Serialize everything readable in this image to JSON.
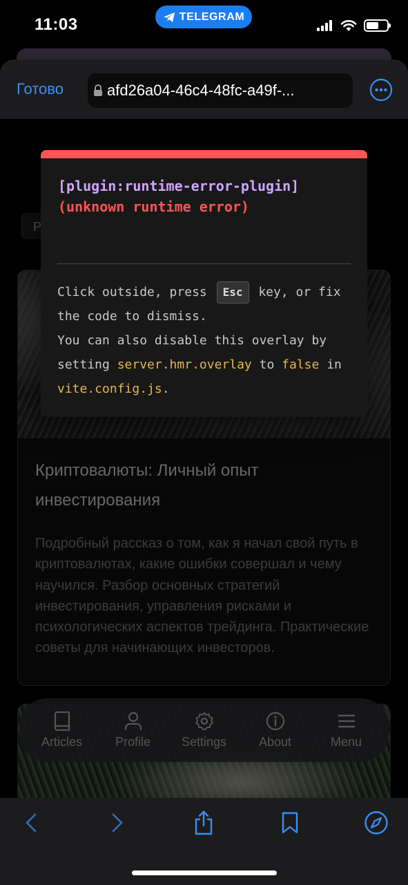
{
  "status_bar": {
    "time": "11:03",
    "telegram_label": "TELEGRAM"
  },
  "browser": {
    "done_label": "Готово",
    "url": "afd26a04-46c4-48fc-a49f-..."
  },
  "page": {
    "filter_chip_label": "P",
    "cards": [
      {
        "title": "Криптовалюты: Личный опыт инвестирования",
        "description": "Подробный рассказ о том, как я начал свой путь в криптовалютах, какие ошибки совершал и чему научился. Разбор основных стратегий инвестирования, управления рисками и психологических аспектов трейдинга. Практические советы для начинающих инвесторов."
      }
    ]
  },
  "app_nav": {
    "items": [
      {
        "label": "Articles",
        "icon": "book-icon"
      },
      {
        "label": "Profile",
        "icon": "user-icon"
      },
      {
        "label": "Settings",
        "icon": "gear-icon"
      },
      {
        "label": "About",
        "icon": "info-icon"
      },
      {
        "label": "Menu",
        "icon": "menu-icon"
      }
    ]
  },
  "error_overlay": {
    "plugin": "[plugin:runtime-error-plugin]",
    "message": "(unknown runtime error)",
    "tip": {
      "part1": "Click outside, press",
      "key": "Esc",
      "part2": "key, or fix the code to dismiss.",
      "part3": "You can also disable this overlay by setting",
      "setting": "server.hmr.overlay",
      "part4": "to",
      "value": "false",
      "part5": "in",
      "file": "vite.config.js",
      "part6": "."
    }
  },
  "colors": {
    "accent_blue": "#3a8ff5",
    "error_red": "#ff5555",
    "plugin_purple": "#cfa5ff",
    "code_yellow": "#e8b64c"
  }
}
